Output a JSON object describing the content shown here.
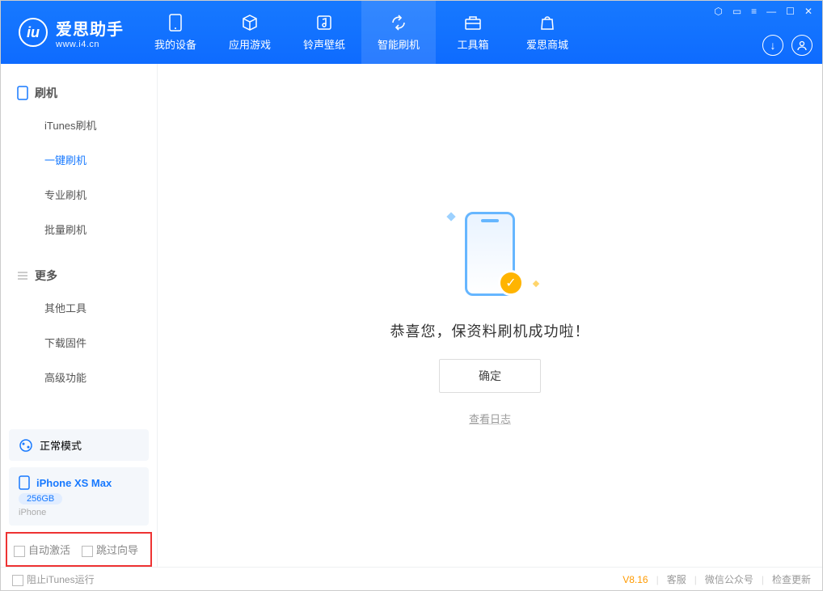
{
  "app": {
    "name_cn": "爱思助手",
    "url": "www.i4.cn"
  },
  "nav": {
    "items": [
      {
        "label": "我的设备",
        "icon": "device"
      },
      {
        "label": "应用游戏",
        "icon": "cube"
      },
      {
        "label": "铃声壁纸",
        "icon": "note"
      },
      {
        "label": "智能刷机",
        "icon": "refresh"
      },
      {
        "label": "工具箱",
        "icon": "toolbox"
      },
      {
        "label": "爱思商城",
        "icon": "bag"
      }
    ],
    "active_index": 3
  },
  "sidebar": {
    "group1": {
      "title": "刷机",
      "items": [
        "iTunes刷机",
        "一键刷机",
        "专业刷机",
        "批量刷机"
      ],
      "active_index": 1
    },
    "group2": {
      "title": "更多",
      "items": [
        "其他工具",
        "下载固件",
        "高级功能"
      ]
    },
    "mode": "正常模式",
    "device": {
      "name": "iPhone XS Max",
      "capacity": "256GB",
      "type": "iPhone"
    },
    "checkboxes": {
      "auto_activate": "自动激活",
      "skip_guide": "跳过向导"
    }
  },
  "main": {
    "message": "恭喜您，保资料刷机成功啦！",
    "ok": "确定",
    "view_log": "查看日志"
  },
  "footer": {
    "block_itunes": "阻止iTunes运行",
    "version": "V8.16",
    "links": [
      "客服",
      "微信公众号",
      "检查更新"
    ]
  }
}
